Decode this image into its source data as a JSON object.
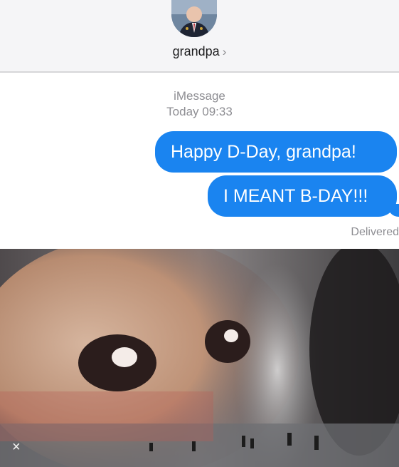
{
  "header": {
    "contact_name": "grandpa",
    "chevron": "›",
    "avatar_icon": "avatar-photo"
  },
  "thread": {
    "service": "iMessage",
    "timestamp": "Today 09:33",
    "messages": [
      {
        "text": "Happy D-Day, grandpa!",
        "from": "me"
      },
      {
        "text": "I MEANT B-DAY!!!",
        "from": "me"
      }
    ],
    "status": "Delivered"
  },
  "overlay": {
    "close_glyph": "×",
    "image_description_icon": "meme-image"
  },
  "colors": {
    "bubble": "#1a84f0",
    "meta_text": "#8e8e93",
    "header_bg": "#f5f5f7"
  }
}
